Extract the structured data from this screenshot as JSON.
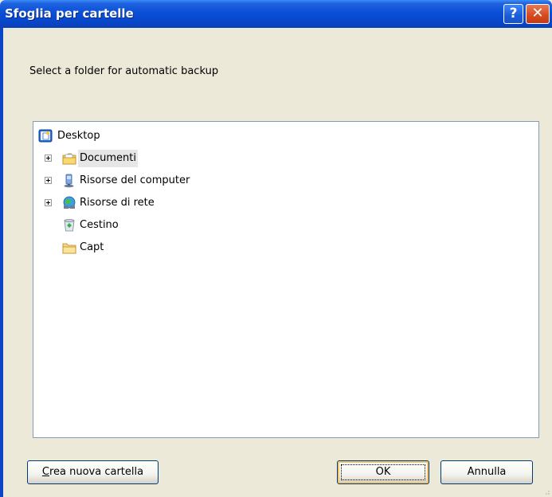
{
  "window": {
    "title": "Sfoglia per cartelle",
    "help_label": "?",
    "close_label": "✕"
  },
  "instruction": "Select a folder for automatic backup",
  "tree": {
    "items": [
      {
        "label": "Desktop",
        "icon": "desktop-icon",
        "expandable": false,
        "selected": false
      },
      {
        "label": "Documenti",
        "icon": "documents-folder-icon",
        "expandable": true,
        "selected": true
      },
      {
        "label": "Risorse del computer",
        "icon": "computer-icon",
        "expandable": true,
        "selected": false
      },
      {
        "label": "Risorse di rete",
        "icon": "network-icon",
        "expandable": true,
        "selected": false
      },
      {
        "label": "Cestino",
        "icon": "recycle-bin-icon",
        "expandable": false,
        "selected": false
      },
      {
        "label": "Capt",
        "icon": "folder-icon",
        "expandable": false,
        "selected": false
      }
    ]
  },
  "buttons": {
    "new_folder_label": "Crea nuova cartella",
    "new_folder_accel": "C",
    "new_folder_rest": "rea nuova cartella",
    "ok_label": "OK",
    "cancel_label": "Annulla"
  },
  "colors": {
    "titlebar": "#0a4fd6",
    "dialog_bg": "#ece9d8",
    "close_button": "#d94c22",
    "selection_bg": "#e6e6e6"
  }
}
